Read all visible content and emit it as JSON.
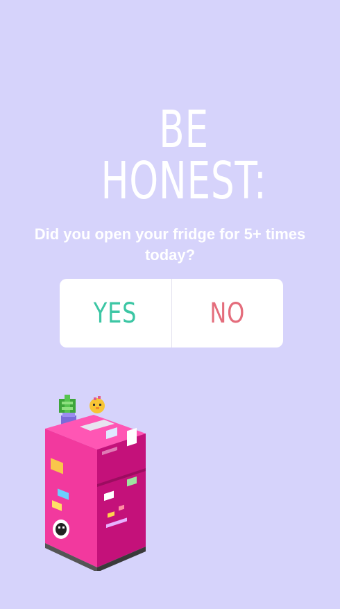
{
  "story": {
    "headline": "BE HONEST:",
    "question": "Did you open your fridge for 5+ times today?",
    "background_color": "#d6d3fb"
  },
  "poll": {
    "options": [
      {
        "label": "YES",
        "color": "#3cc6a4"
      },
      {
        "label": "NO",
        "color": "#e46d7c"
      }
    ]
  },
  "sticker": {
    "icon": "pixel-fridge-icon",
    "color": "#f0349b"
  }
}
